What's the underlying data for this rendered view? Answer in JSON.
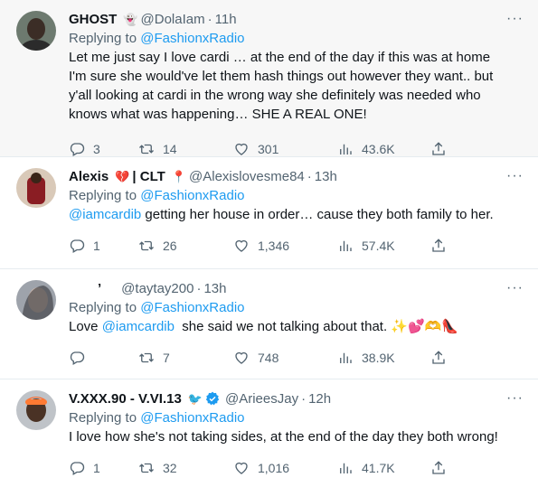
{
  "tweets": [
    {
      "name": "GHOST",
      "name_emoji": "👻",
      "handle": "@DolaIam",
      "time": "11h",
      "replying_prefix": "Replying to",
      "replying_to": "@FashionxRadio",
      "text": "Let me just say I love cardi … at the end of the day if this was at home I'm sure she would've let them hash things out however they want.. but y'all looking at cardi in the wrong way she definitely was needed who knows what was happening… SHE A REAL ONE!",
      "replies": "3",
      "retweets": "14",
      "likes": "301",
      "views": "43.6K"
    },
    {
      "name": "Alexis",
      "name_emoji": "💔",
      "name_suffix": "| CLT",
      "name_suffix_emoji": "📍",
      "handle": "@Alexislovesme84",
      "time": "13h",
      "replying_prefix": "Replying to",
      "replying_to": "@FashionxRadio",
      "text_mention": "@iamcardib",
      "text": " getting her house in order… cause they both family to her.",
      "replies": "1",
      "retweets": "26",
      "likes": "1,346",
      "views": "57.4K"
    },
    {
      "name": "’",
      "handle": "@taytay200",
      "time": "13h",
      "replying_prefix": "Replying to",
      "replying_to": "@FashionxRadio",
      "text_prefix": "Love ",
      "text_mention": "@iamcardib",
      "text": "  she said we not talking about that. ",
      "text_emojis": "✨💕🫶👠",
      "replies": "",
      "retweets": "7",
      "likes": "748",
      "views": "38.9K"
    },
    {
      "name": "V.XXX.90 - V.VI.13",
      "name_symbol": "🐦",
      "handle": "@ArieesJay",
      "time": "12h",
      "replying_prefix": "Replying to",
      "replying_to": "@FashionxRadio",
      "text": "I love how she's not taking sides, at the end of the day they both wrong!",
      "replies": "1",
      "retweets": "32",
      "likes": "1,016",
      "views": "41.7K"
    }
  ],
  "ui": {
    "more_label": "···",
    "dot": "·",
    "icons": [
      "reply-icon",
      "retweet-icon",
      "like-icon",
      "views-icon",
      "share-icon"
    ],
    "verified_color": "#1d9bf0"
  }
}
